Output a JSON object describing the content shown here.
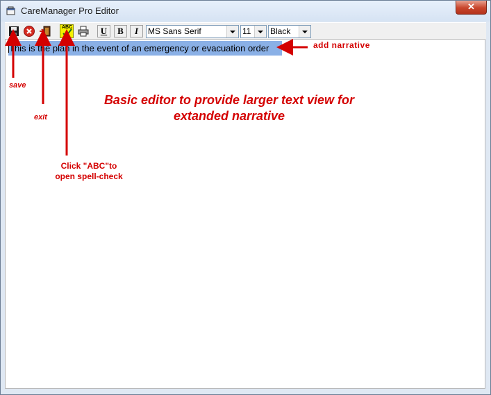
{
  "window": {
    "title": "CareManager Pro Editor"
  },
  "toolbar": {
    "save": {
      "icon": "floppy-icon"
    },
    "cancel": {
      "icon": "red-x-icon"
    },
    "exit": {
      "icon": "exit-door-icon"
    },
    "spellcheck": {
      "label": "ABC",
      "icon": "spellcheck-icon"
    },
    "print": {
      "icon": "printer-icon"
    },
    "underline_label": "U",
    "bold_label": "B",
    "italic_label": "I",
    "font_name": "MS Sans Serif",
    "font_size": "11",
    "font_color": "Black"
  },
  "editor": {
    "text": "This is the plan in the event of an emergency or evacuation order"
  },
  "annotations": {
    "save": "save",
    "exit": "exit",
    "spellcheck_line1": "Click \"ABC\"to",
    "spellcheck_line2": "open spell-check",
    "add_narrative": "add narrative",
    "headline_line1": "Basic editor to provide larger text view for",
    "headline_line2": "extanded narrative"
  },
  "colors": {
    "annotation": "#d40000",
    "selection": "#8ab0e6",
    "spellcheck_button": "#f4f000"
  }
}
